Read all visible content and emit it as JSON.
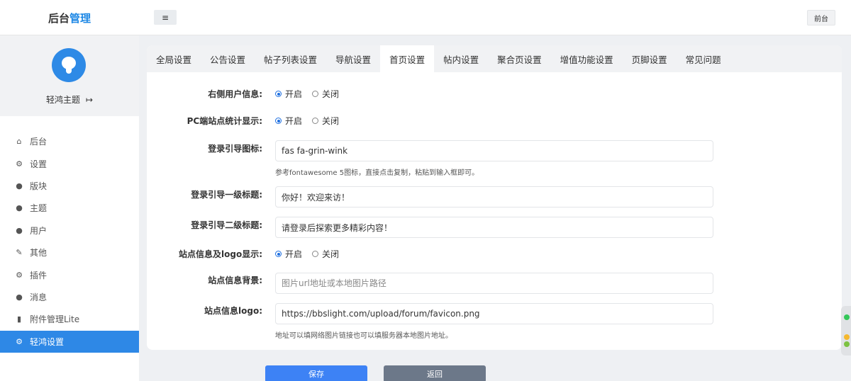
{
  "header": {
    "logo_main": "后台",
    "logo_accent": "管理",
    "menu_toggle": "≡",
    "front_button": "前台"
  },
  "sidebar": {
    "profile_name": "轻鸿主题",
    "items": [
      {
        "label": "后台",
        "icon": "home-icon",
        "glyph": "⌂"
      },
      {
        "label": "设置",
        "icon": "gear-icon",
        "glyph": "⚙"
      },
      {
        "label": "版块",
        "icon": "comment-icon",
        "glyph": "●"
      },
      {
        "label": "主题",
        "icon": "comment-icon",
        "glyph": "●"
      },
      {
        "label": "用户",
        "icon": "user-icon",
        "glyph": "●"
      },
      {
        "label": "其他",
        "icon": "wrench-icon",
        "glyph": "✎"
      },
      {
        "label": "插件",
        "icon": "cogs-icon",
        "glyph": "⚙"
      },
      {
        "label": "消息",
        "icon": "bell-icon",
        "glyph": "●"
      },
      {
        "label": "附件管理Lite",
        "icon": "file-icon",
        "glyph": "▮"
      },
      {
        "label": "轻鸿设置",
        "icon": "gear-icon",
        "glyph": "⚙"
      }
    ]
  },
  "tabs": [
    "全局设置",
    "公告设置",
    "帖子列表设置",
    "导航设置",
    "首页设置",
    "帖内设置",
    "聚合页设置",
    "增值功能设置",
    "页脚设置",
    "常见问题"
  ],
  "form": {
    "right_user_info": {
      "label": "右侧用户信息:",
      "on": "开启",
      "off": "关闭"
    },
    "pc_stats": {
      "label": "PC端站点统计显示:",
      "on": "开启",
      "off": "关闭"
    },
    "login_icon": {
      "label": "登录引导图标:",
      "value": "fas fa-grin-wink",
      "hint": "参考fontawesome 5图标，直接点击复制，粘贴到输入框即可。"
    },
    "login_title1": {
      "label": "登录引导一级标题:",
      "value": "你好！欢迎来访！"
    },
    "login_title2": {
      "label": "登录引导二级标题:",
      "value": "请登录后探索更多精彩内容！"
    },
    "site_logo_display": {
      "label": "站点信息及logo显示:",
      "on": "开启",
      "off": "关闭"
    },
    "site_bg": {
      "label": "站点信息背景:",
      "value": "",
      "placeholder": "图片url地址或本地图片路径"
    },
    "site_logo": {
      "label": "站点信息logo:",
      "value": "https://bbslight.com/upload/forum/favicon.png",
      "hint": "地址可以填网络图片链接也可以填服务器本地图片地址。"
    }
  },
  "buttons": {
    "save": "保存",
    "back": "返回"
  },
  "colors": {
    "accent": "#2e88e6",
    "save": "#3d82f5",
    "back": "#6c7889"
  }
}
